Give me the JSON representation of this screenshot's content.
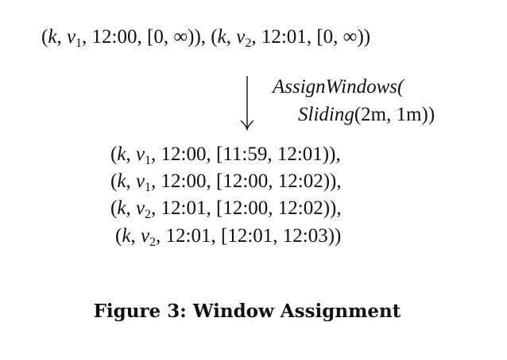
{
  "input": {
    "elements": [
      {
        "key": "k",
        "value_base": "v",
        "value_sub": "1",
        "time": "12:00",
        "window": "[0, ∞)"
      },
      {
        "key": "k",
        "value_base": "v",
        "value_sub": "2",
        "time": "12:01",
        "window": "[0, ∞)"
      }
    ]
  },
  "operation": {
    "line1": "AssignWindows(",
    "line2_fn": "Sliding",
    "line2_args": "(2m, 1m))"
  },
  "output": {
    "elements": [
      {
        "key": "k",
        "value_base": "v",
        "value_sub": "1",
        "time": "12:00",
        "window": "[11:59, 12:01)",
        "suffix": "),"
      },
      {
        "key": "k",
        "value_base": "v",
        "value_sub": "1",
        "time": "12:00",
        "window": "[12:00, 12:02)",
        "suffix": "),"
      },
      {
        "key": "k",
        "value_base": "v",
        "value_sub": "2",
        "time": "12:01",
        "window": "[12:00, 12:02)",
        "suffix": "),"
      },
      {
        "key": "k",
        "value_base": "v",
        "value_sub": "2",
        "time": "12:01",
        "window": "[12:01, 12:03)",
        "suffix": ")"
      }
    ]
  },
  "caption": {
    "text": "Figure 3:  Window Assignment"
  }
}
